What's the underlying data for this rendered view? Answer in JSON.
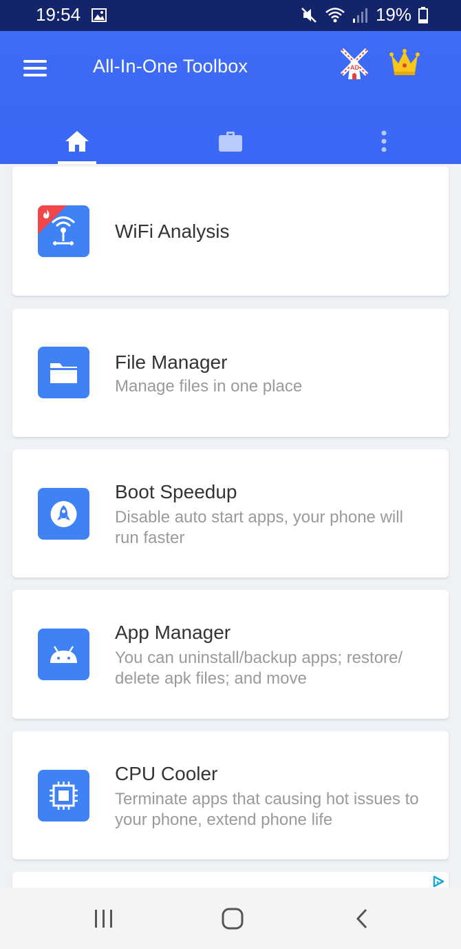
{
  "status_bar": {
    "time": "19:54",
    "battery": "19%"
  },
  "header": {
    "title": "All-In-One Toolbox",
    "ad_icon_label": "AD"
  },
  "tabs": [
    {
      "name": "home",
      "icon": "home-icon",
      "active": true
    },
    {
      "name": "tools",
      "icon": "briefcase-icon",
      "active": false
    },
    {
      "name": "more",
      "icon": "more-vertical-icon",
      "active": false
    }
  ],
  "cards": [
    {
      "title": "WiFi Analysis",
      "description": "",
      "icon": "wifi-router-icon",
      "hot": true
    },
    {
      "title": "File Manager",
      "description": "Manage files in one place",
      "icon": "folder-icon"
    },
    {
      "title": "Boot Speedup",
      "description": "Disable auto start apps, your phone will run faster",
      "icon": "rocket-icon"
    },
    {
      "title": "App Manager",
      "description": "You can uninstall/backup apps; restore/ delete apk files; and move",
      "icon": "android-icon"
    },
    {
      "title": "CPU Cooler",
      "description": "Terminate apps that causing hot issues to your phone, extend phone life",
      "icon": "cpu-chip-icon"
    }
  ],
  "colors": {
    "status_bar": "#14246b",
    "header": "#3f6cf5",
    "card_icon": "#3f82f6",
    "hot_badge": "#f2474a",
    "background": "#eef1f6"
  }
}
